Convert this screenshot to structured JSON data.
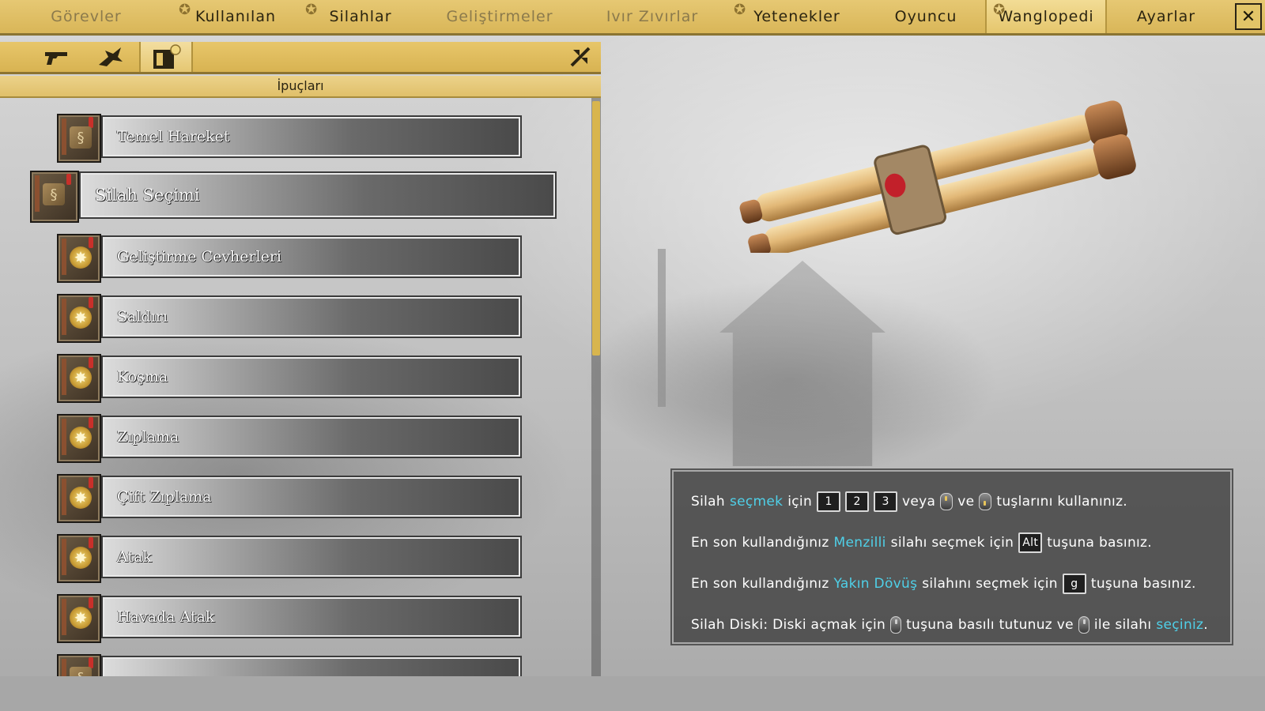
{
  "nav": {
    "tabs": [
      {
        "label": "Görevler",
        "dim": true,
        "badge": false
      },
      {
        "label": "Kullanılan",
        "dim": false,
        "badge": true
      },
      {
        "label": "Silahlar",
        "dim": false,
        "badge": true
      },
      {
        "label": "Geliştirmeler",
        "dim": true,
        "badge": false
      },
      {
        "label": "Ivır Zıvırlar",
        "dim": true,
        "badge": false
      },
      {
        "label": "Yetenekler",
        "dim": false,
        "badge": true
      },
      {
        "label": "Oyuncu",
        "dim": false,
        "badge": false
      },
      {
        "label": "Wanglopedi",
        "dim": false,
        "badge": true,
        "active": true
      },
      {
        "label": "Ayarlar",
        "dim": false,
        "badge": false
      }
    ],
    "close_label": "✕"
  },
  "subnav": {
    "icons": [
      "pistol-icon",
      "creature-icon",
      "book-icon"
    ],
    "active_index": 2,
    "right_icon": "slash-icon"
  },
  "section": {
    "title": "İpuçları"
  },
  "list": {
    "items": [
      {
        "label": "Temel Hareket",
        "icon": "dragon",
        "selected": false
      },
      {
        "label": "Silah Seçimi",
        "icon": "dragon",
        "selected": true
      },
      {
        "label": "Geliştirme Cevherleri",
        "icon": "star",
        "selected": false
      },
      {
        "label": "Saldırı",
        "icon": "star",
        "selected": false
      },
      {
        "label": "Koşma",
        "icon": "star",
        "selected": false
      },
      {
        "label": "Zıplama",
        "icon": "star",
        "selected": false
      },
      {
        "label": "Çift Zıplama",
        "icon": "star",
        "selected": false
      },
      {
        "label": "Atak",
        "icon": "star",
        "selected": false
      },
      {
        "label": "Havada Atak",
        "icon": "star",
        "selected": false
      },
      {
        "label": "",
        "icon": "dragon",
        "selected": false
      }
    ]
  },
  "info": {
    "line1": {
      "a": "Silah",
      "b": "seçmek",
      "c": "için",
      "k1": "1",
      "k2": "2",
      "k3": "3",
      "d": "veya",
      "e": "ve",
      "f": "tuşlarını kullanınız."
    },
    "line2": {
      "a": "En son kullandığınız",
      "b": "Menzilli",
      "c": "silahı seçmek için",
      "k": "Alt",
      "d": "tuşuna basınız."
    },
    "line3": {
      "a": "En son kullandığınız",
      "b": "Yakın Dövüş",
      "c": "silahını seçmek için",
      "k": "g",
      "d": "tuşuna basınız."
    },
    "line4": {
      "a": "Silah Diski: Diski açmak için",
      "b": "tuşuna basılı tutunuz ve",
      "c": "ile silahı",
      "d": "seçiniz",
      "e": "."
    }
  },
  "colors": {
    "accent": "#d9b658",
    "highlight": "#4fd0e8"
  }
}
